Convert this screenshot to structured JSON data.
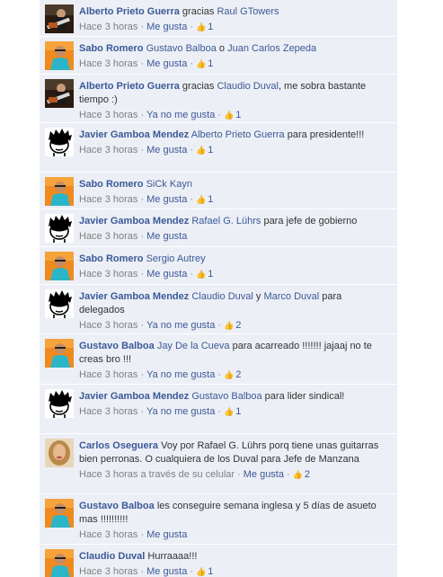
{
  "colors": {
    "link": "#3b5998",
    "meta": "#808080",
    "background": "#eceff5"
  },
  "comments": [
    {
      "avatar": "guitarist-avatar",
      "author": "Alberto Prieto Guerra",
      "segments": [
        {
          "t": "gracias "
        },
        {
          "t": "Raul GTowers",
          "m": true
        }
      ],
      "time": "Hace 3 horas",
      "via": "",
      "action": "Me gusta",
      "likes": "1"
    },
    {
      "avatar": "orange-man-avatar",
      "author": "Sabo Romero",
      "segments": [
        {
          "t": "Gustavo Balboa",
          "m": true
        },
        {
          "t": " o "
        },
        {
          "t": "Juan Carlos Zepeda",
          "m": true
        }
      ],
      "time": "Hace 3 horas",
      "via": "",
      "action": "Me gusta",
      "likes": "1"
    },
    {
      "avatar": "guitarist-avatar",
      "author": "Alberto Prieto Guerra",
      "segments": [
        {
          "t": "gracias "
        },
        {
          "t": "Claudio Duval",
          "m": true
        },
        {
          "t": ", me sobra bastante tiempo :)"
        }
      ],
      "time": "Hace 3 horas",
      "via": "",
      "action": "Ya no me gusta",
      "likes": "1"
    },
    {
      "avatar": "cartoon-face-avatar",
      "author": "Javier Gamboa Mendez",
      "segments": [
        {
          "t": "Alberto Prieto Guerra",
          "m": true
        },
        {
          "t": " para presidente!!!"
        }
      ],
      "time": "Hace 3 horas",
      "via": "",
      "action": "Me gusta",
      "likes": "1"
    },
    {
      "avatar": "orange-man-avatar",
      "author": "Sabo Romero",
      "segments": [
        {
          "t": "SiCk Kayn",
          "m": true
        }
      ],
      "time": "Hace 3 horas",
      "via": "",
      "action": "Me gusta",
      "likes": "1"
    },
    {
      "avatar": "cartoon-face-avatar",
      "author": "Javier Gamboa Mendez",
      "segments": [
        {
          "t": "Rafael G. Lührs",
          "m": true
        },
        {
          "t": " para jefe de gobierno"
        }
      ],
      "time": "Hace 3 horas",
      "via": "",
      "action": "Me gusta",
      "likes": ""
    },
    {
      "avatar": "orange-man-avatar",
      "author": "Sabo Romero",
      "segments": [
        {
          "t": "Sergio Autrey",
          "m": true
        }
      ],
      "time": "Hace 3 horas",
      "via": "",
      "action": "Me gusta",
      "likes": "1"
    },
    {
      "avatar": "cartoon-face-avatar",
      "author": "Javier Gamboa Mendez",
      "segments": [
        {
          "t": "Claudio Duval",
          "m": true
        },
        {
          "t": " y "
        },
        {
          "t": "Marco Duval",
          "m": true
        },
        {
          "t": " para delegados"
        }
      ],
      "time": "Hace 3 horas",
      "via": "",
      "action": "Ya no me gusta",
      "likes": "2"
    },
    {
      "avatar": "orange-man-avatar",
      "author": "Gustavo Balboa",
      "segments": [
        {
          "t": "Jay De la Cueva",
          "m": true
        },
        {
          "t": " para acarreado !!!!!!! jajaaj no te creas bro !!!"
        }
      ],
      "time": "Hace 3 horas",
      "via": "",
      "action": "Ya no me gusta",
      "likes": "2"
    },
    {
      "avatar": "cartoon-face-avatar",
      "author": "Javier Gamboa Mendez",
      "segments": [
        {
          "t": "Gustavo Balboa",
          "m": true
        },
        {
          "t": " para lider sindical!"
        }
      ],
      "time": "Hace 3 horas",
      "via": "",
      "action": "Ya no me gusta",
      "likes": "1"
    },
    {
      "avatar": "woman-avatar",
      "author": "Carlos Oseguera",
      "segments": [
        {
          "t": "Voy por Rafael G. Lührs porq tiene unas guitarras bien perronas. O cualquiera de los Duval para Jefe de Manzana"
        }
      ],
      "time": "Hace 3 horas",
      "via": "a través de su celular",
      "action": "Me gusta",
      "likes": "2"
    },
    {
      "avatar": "orange-man-avatar",
      "author": "Gustavo Balboa",
      "segments": [
        {
          "t": "les conseguire semana inglesa y 5 días de asueto mas !!!!!!!!!!"
        }
      ],
      "time": "Hace 3 horas",
      "via": "",
      "action": "Me gusta",
      "likes": ""
    },
    {
      "avatar": "orange-man-avatar",
      "author": "Claudio Duval",
      "segments": [
        {
          "t": "Hurraaaa!!!"
        }
      ],
      "time": "Hace 3 horas",
      "via": "",
      "action": "Me gusta",
      "likes": "1"
    }
  ]
}
